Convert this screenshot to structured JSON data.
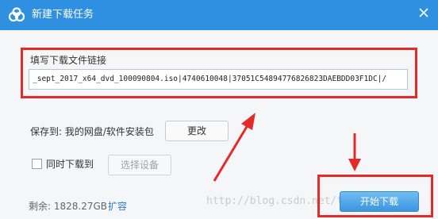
{
  "window": {
    "title": "新建下载任务",
    "icons": {
      "logo": "baidu-cloud-logo",
      "close": "close-icon"
    },
    "accent": "#2f8fe0"
  },
  "download": {
    "section_label": "填写下载文件链接",
    "url": "_sept_2017_x64_dvd_100090804.iso|4740610048|37051C54894776826823DAEBDD03F1DC|/"
  },
  "save": {
    "label": "保存到: 我的网盘/软件安装包",
    "change_button": "更改"
  },
  "sync": {
    "checkbox_label": "同时下载到",
    "checked": false,
    "select_device_button": "选择设备"
  },
  "footer": {
    "remaining": "剩余: 1828.27GB",
    "expand_link": "扩容",
    "start_button": "开始下载"
  },
  "watermark": "http://blog.csdn.net/tt1000",
  "annotation_color": "#e52a2a"
}
